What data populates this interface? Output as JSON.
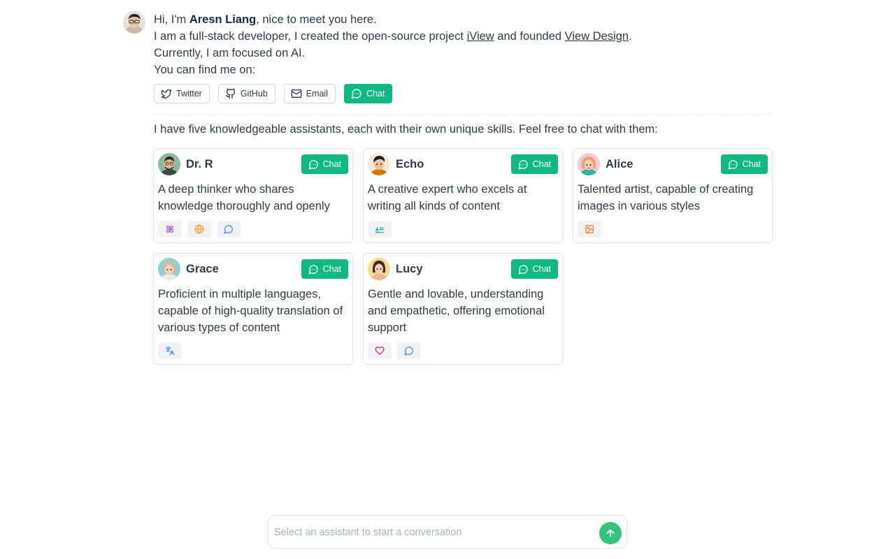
{
  "intro": {
    "greeting_prefix": "Hi, I'm ",
    "name": "Aresn Liang",
    "greeting_suffix": ", nice to meet you here.",
    "line2_prefix": "I am a full-stack developer, I created the open-source project ",
    "link1": "iView",
    "line2_mid": " and founded ",
    "link2": "View Design",
    "line2_suffix": ".",
    "line3": "Currently, I am focused on AI.",
    "line4": "You can find me on:"
  },
  "social": [
    {
      "label": "Twitter",
      "icon": "twitter-icon"
    },
    {
      "label": "GitHub",
      "icon": "github-icon"
    },
    {
      "label": "Email",
      "icon": "mail-icon"
    },
    {
      "label": "Chat",
      "icon": "chat-icon"
    }
  ],
  "assistants_intro": "I have five knowledgeable assistants, each with their own unique skills. Feel free to chat with them:",
  "assistants": [
    {
      "name": "Dr. R",
      "chat_label": "Chat",
      "description": "A deep thinker who shares knowledge thoroughly and openly",
      "tags": [
        "atom-icon",
        "globe-icon",
        "message-icon"
      ]
    },
    {
      "name": "Echo",
      "chat_label": "Chat",
      "description": "A creative expert who excels at writing all kinds of content",
      "tags": [
        "text-icon"
      ]
    },
    {
      "name": "Alice",
      "chat_label": "Chat",
      "description": "Talented artist, capable of creating images in various styles",
      "tags": [
        "image-icon"
      ]
    },
    {
      "name": "Grace",
      "chat_label": "Chat",
      "description": "Proficient in multiple languages, capable of high-quality translation of various types of content",
      "tags": [
        "translate-icon"
      ]
    },
    {
      "name": "Lucy",
      "chat_label": "Chat",
      "description": "Gentle and lovable, understanding and empathetic, offering emotional support",
      "tags": [
        "heart-icon",
        "message-icon"
      ]
    }
  ],
  "composer": {
    "placeholder": "Select an assistant to start a conversation",
    "value": ""
  },
  "colors": {
    "accent": "#10b981",
    "text": "#2f3a4a",
    "border": "#dfe2e6"
  }
}
